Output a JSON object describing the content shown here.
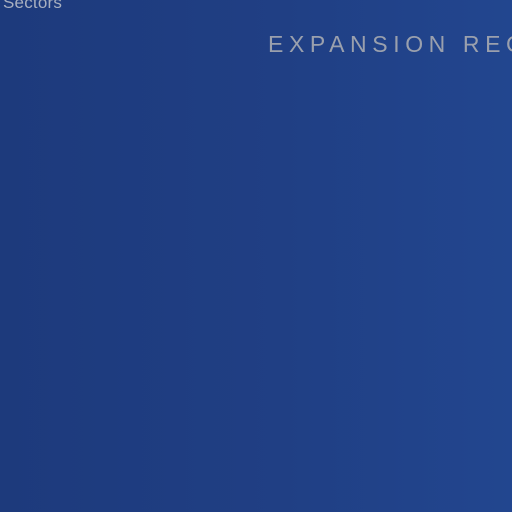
{
  "nav": {
    "sectors_label": "Sectors"
  },
  "section": {
    "heading": "EXPANSION REG"
  },
  "colors": {
    "background_left": "#1d3a7c",
    "background_right": "#22468f",
    "text_muted": "#9aa0ad"
  }
}
